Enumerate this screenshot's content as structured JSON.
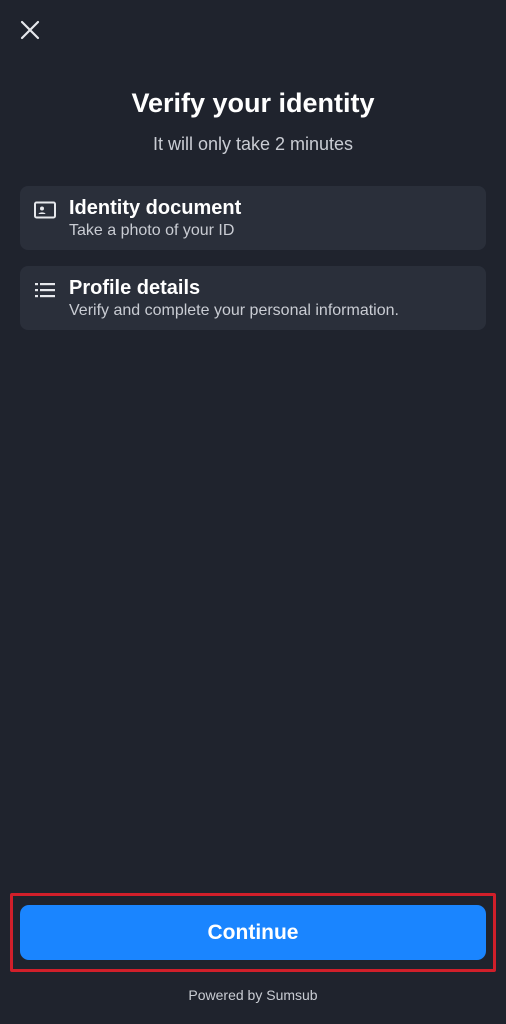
{
  "header": {
    "close_icon": "close-icon"
  },
  "intro": {
    "title": "Verify your identity",
    "subtitle": "It will only take 2 minutes"
  },
  "steps": [
    {
      "icon": "id-card-icon",
      "title": "Identity document",
      "description": "Take a photo of your ID"
    },
    {
      "icon": "list-icon",
      "title": "Profile details",
      "description": "Verify and complete your personal information."
    }
  ],
  "footer": {
    "continue_label": "Continue",
    "powered_by": "Powered by Sumsub"
  },
  "colors": {
    "background": "#1f232d",
    "card": "#2a2f3a",
    "accent": "#1a85ff",
    "highlight": "#d11f2a",
    "secondary_text": "#c9ccd3"
  }
}
